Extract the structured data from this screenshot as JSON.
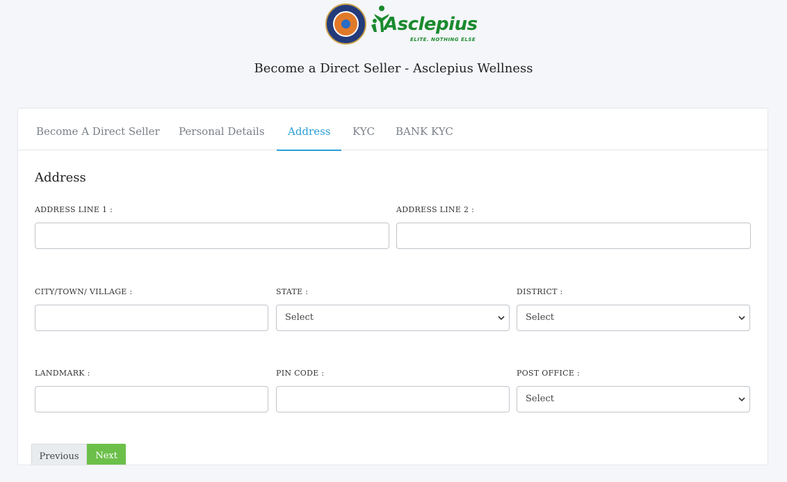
{
  "header": {
    "brand_name": "Asclepius",
    "brand_tagline": "ELITE. NOTHING ELSE",
    "page_title": "Become a Direct Seller - Asclepius Wellness"
  },
  "tabs": [
    {
      "label": "Become A Direct Seller",
      "active": false
    },
    {
      "label": "Personal Details",
      "active": false
    },
    {
      "label": "Address",
      "active": true
    },
    {
      "label": "KYC",
      "active": false
    },
    {
      "label": "BANK KYC",
      "active": false
    }
  ],
  "form": {
    "section_title": "Address",
    "address_line1": {
      "label": "ADDRESS LINE 1 :",
      "value": "",
      "placeholder": ""
    },
    "address_line2": {
      "label": "ADDRESS LINE 2 :",
      "value": "",
      "placeholder": ""
    },
    "city": {
      "label": "CITY/TOWN/ VILLAGE :",
      "value": "",
      "placeholder": ""
    },
    "state": {
      "label": "STATE :",
      "selected": "Select"
    },
    "district": {
      "label": "DISTRICT :",
      "selected": "Select"
    },
    "landmark": {
      "label": "LANDMARK :",
      "value": "",
      "placeholder": ""
    },
    "pincode": {
      "label": "PIN CODE :",
      "value": "",
      "placeholder": ""
    },
    "post_office": {
      "label": "POST OFFICE :",
      "selected": "Select"
    }
  },
  "buttons": {
    "previous_label": "Previous",
    "next_label": "Next"
  },
  "colors": {
    "accent": "#2a9fd6",
    "brand_green": "#1a8a2e",
    "next_button": "#6cc04a"
  }
}
